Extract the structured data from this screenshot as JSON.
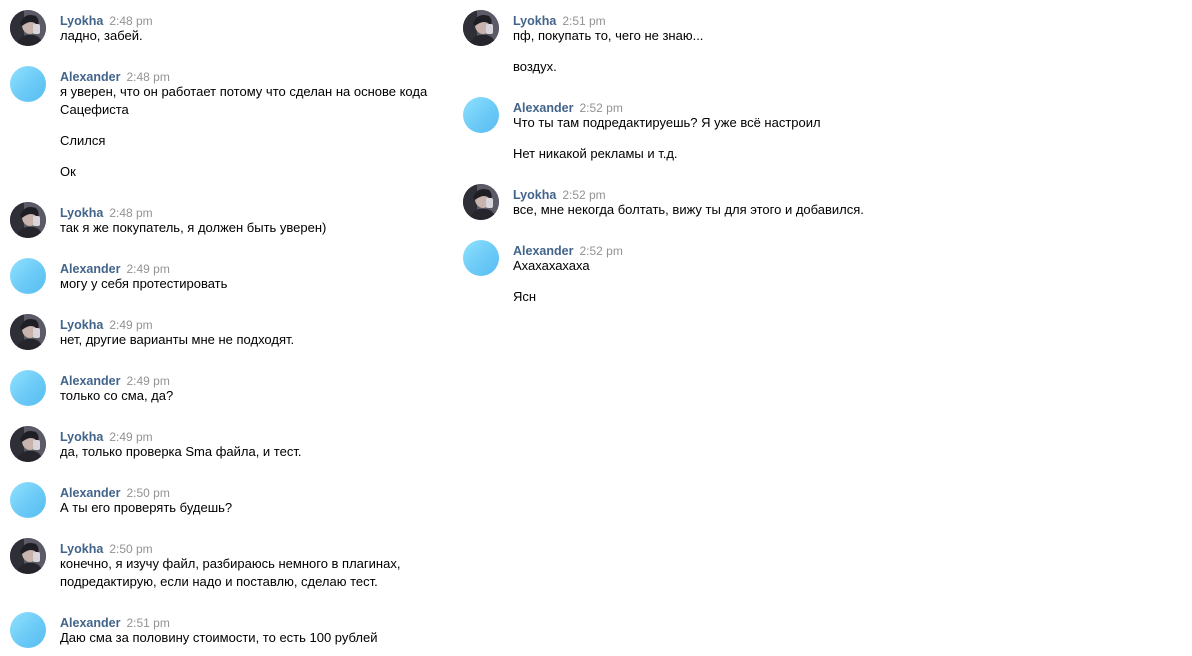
{
  "left_column": [
    {
      "author": "Lyokha",
      "time": "2:48 pm",
      "lines": [
        "ладно, забей."
      ]
    },
    {
      "author": "Alexander",
      "time": "2:48 pm",
      "lines": [
        "я уверен, что он работает потому что сделан на основе кода",
        "Сацефиста",
        "Слился",
        "Ок"
      ]
    },
    {
      "author": "Lyokha",
      "time": "2:48 pm",
      "lines": [
        "так я же покупатель, я должен быть уверен)"
      ]
    },
    {
      "author": "Alexander",
      "time": "2:49 pm",
      "lines": [
        "могу у себя протестировать"
      ]
    },
    {
      "author": "Lyokha",
      "time": "2:49 pm",
      "lines": [
        "нет, другие варианты мне не подходят."
      ]
    },
    {
      "author": "Alexander",
      "time": "2:49 pm",
      "lines": [
        "только со сма, да?"
      ]
    },
    {
      "author": "Lyokha",
      "time": "2:49 pm",
      "lines": [
        "да, только проверка Sma файла, и тест."
      ]
    },
    {
      "author": "Alexander",
      "time": "2:50 pm",
      "lines": [
        "А ты его проверять будешь?"
      ]
    },
    {
      "author": "Lyokha",
      "time": "2:50 pm",
      "lines": [
        "конечно, я изучу файл, разбираюсь немного в плагинах,",
        "подредактирую, если надо и поставлю, сделаю тест."
      ]
    },
    {
      "author": "Alexander",
      "time": "2:51 pm",
      "lines": [
        "Даю сма за половину стоимости, то есть 100 рублей"
      ]
    }
  ],
  "right_column": [
    {
      "author": "Lyokha",
      "time": "2:51 pm",
      "lines": [
        "пф, покупать то, чего не знаю...",
        "воздух."
      ]
    },
    {
      "author": "Alexander",
      "time": "2:52 pm",
      "lines": [
        "Что ты там подредактируешь? Я уже всё настроил",
        "Нет никакой рекламы и т.д."
      ]
    },
    {
      "author": "Lyokha",
      "time": "2:52 pm",
      "lines": [
        "все, мне некогда болтать, вижу ты для этого и добавился."
      ]
    },
    {
      "author": "Alexander",
      "time": "2:52 pm",
      "lines": [
        "Ахахахахаха",
        "Ясн"
      ]
    }
  ],
  "colors": {
    "name": "#42648b",
    "time": "#939393",
    "text": "#000000",
    "alexander_avatar": "#6ccaf6"
  }
}
